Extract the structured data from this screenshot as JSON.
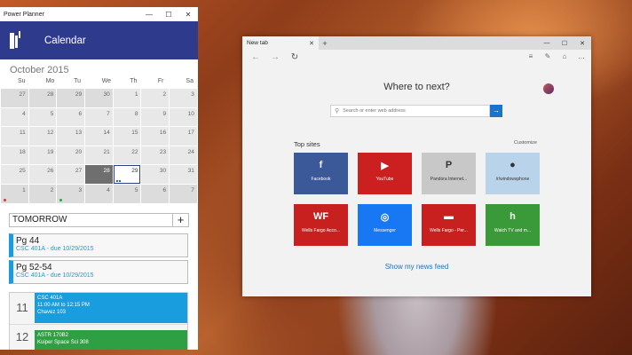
{
  "power_planner": {
    "title": "Power Planner",
    "header_title": "Calendar",
    "month": "October 2015",
    "weekdays": [
      "Su",
      "Mo",
      "Tu",
      "We",
      "Th",
      "Fr",
      "Sa"
    ],
    "weeks": [
      [
        "27",
        "28",
        "29",
        "30",
        "1",
        "2",
        "3"
      ],
      [
        "4",
        "5",
        "6",
        "7",
        "8",
        "9",
        "10"
      ],
      [
        "11",
        "12",
        "13",
        "14",
        "15",
        "16",
        "17"
      ],
      [
        "18",
        "19",
        "20",
        "21",
        "22",
        "23",
        "24"
      ],
      [
        "25",
        "26",
        "27",
        "28",
        "29",
        "30",
        "31"
      ],
      [
        "1",
        "2",
        "3",
        "4",
        "5",
        "6",
        "7"
      ]
    ],
    "schedule_label": "TOMORROW",
    "tasks": [
      {
        "title": "Pg 44",
        "sub": "CSC 401A - due 10/29/2015"
      },
      {
        "title": "Pg 52-54",
        "sub": "CSC 401A - due 10/29/2015"
      }
    ],
    "hours": [
      "11",
      "12"
    ],
    "events": [
      {
        "line1": "CSC 401A",
        "line2": "11:00 AM to 12:15 PM",
        "line3": "Chavez 103",
        "color": "#1a9ddf"
      },
      {
        "line1": "ASTR 170B2",
        "line2": "12:30 PM to 1:45 PM",
        "line3": "Kuiper Space Sci 308",
        "color": "#2ea043"
      }
    ],
    "colors": {
      "header": "#2e3b8c",
      "task_accent": "#1a9ddf"
    }
  },
  "edge": {
    "tab_title": "New tab",
    "heading": "Where to next?",
    "search_placeholder": "Search or enter web address",
    "top_sites_label": "Top sites",
    "customize_label": "Customize",
    "tiles": [
      {
        "label": "Facebook",
        "icon": "f",
        "color": "#3b5998",
        "light": false
      },
      {
        "label": "YouTube",
        "icon": "▶",
        "color": "#cc1f1f",
        "light": false
      },
      {
        "label": "Pandora Internet...",
        "icon": "P",
        "color": "#c8c8c8",
        "light": true
      },
      {
        "label": "/r/windowsphone",
        "icon": "●",
        "color": "#b9d3ea",
        "light": true
      },
      {
        "label": "Wells Fargo Acco...",
        "icon": "WF",
        "color": "#c8201f",
        "light": false
      },
      {
        "label": "Messenger",
        "icon": "◎",
        "color": "#1877f2",
        "light": false
      },
      {
        "label": "Wells Fargo - Per...",
        "icon": "▬",
        "color": "#c8201f",
        "light": false
      },
      {
        "label": "Watch TV and m...",
        "icon": "h",
        "color": "#3a9a3a",
        "light": false
      }
    ],
    "news_link": "Show my news feed",
    "accent": "#1a73c8"
  }
}
